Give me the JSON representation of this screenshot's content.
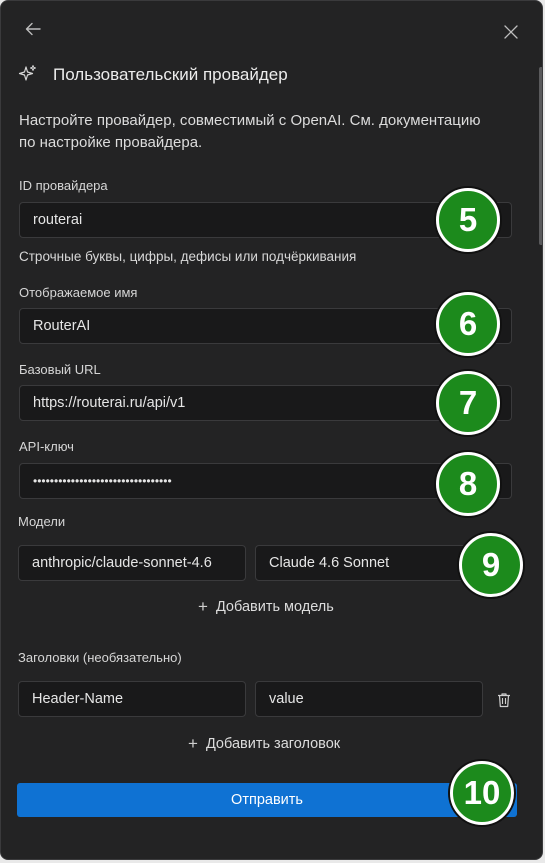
{
  "header": {
    "back_icon": "arrow-left-icon",
    "close_icon": "close-icon",
    "title_icon": "sparkles-icon",
    "title": "Пользовательский провайдер"
  },
  "description": {
    "line1": "Настройте провайдер, совместимый с OpenAI. См. документацию",
    "line2": "по настройке провайдера."
  },
  "fields": {
    "provider_id": {
      "label": "ID провайдера",
      "value": "routerai",
      "hint": "Строчные буквы, цифры, дефисы или подчёркивания"
    },
    "display_name": {
      "label": "Отображаемое имя",
      "value": "RouterAI"
    },
    "base_url": {
      "label": "Базовый URL",
      "value": "https://routerai.ru/api/v1"
    },
    "api_key": {
      "label": "API-ключ",
      "value": "•••••••••••••••••••••••••••••••••"
    }
  },
  "models": {
    "label": "Модели",
    "rows": [
      {
        "id": "anthropic/claude-sonnet-4.6",
        "name": "Claude 4.6 Sonnet"
      }
    ],
    "add_label": "Добавить модель"
  },
  "headers": {
    "label": "Заголовки (необязательно)",
    "rows": [
      {
        "name": "Header-Name",
        "value": "value"
      }
    ],
    "delete_icon": "trash-icon",
    "add_label": "Добавить заголовок"
  },
  "submit_label": "Отправить",
  "badges": [
    "5",
    "6",
    "7",
    "8",
    "9",
    "10"
  ],
  "colors": {
    "accent": "#0f72d3",
    "badge": "#1c8a1c",
    "background": "#232324"
  }
}
